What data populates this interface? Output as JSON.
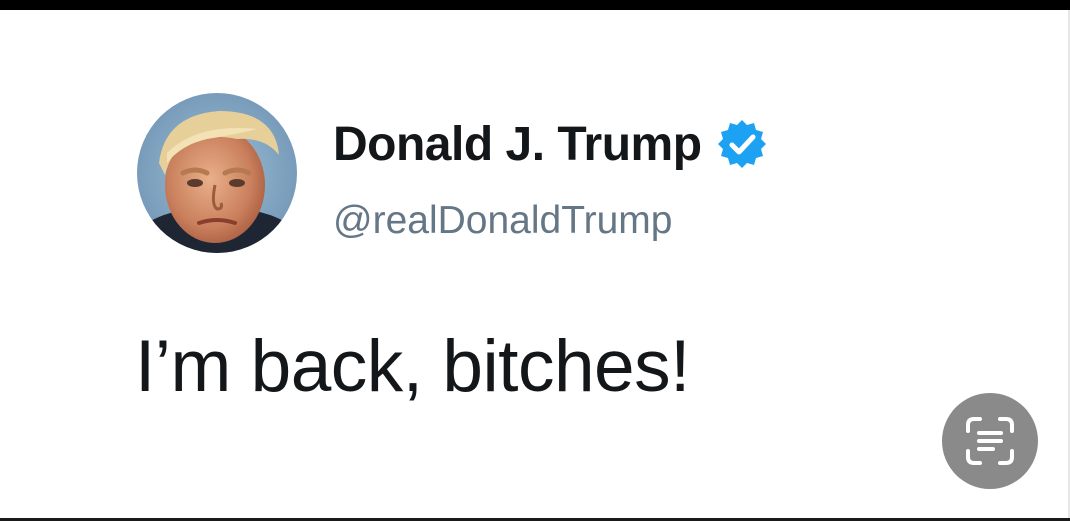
{
  "tweet": {
    "display_name": "Donald J. Trump",
    "handle": "@realDonaldTrump",
    "text": "I’m back, bitches!",
    "verified": true
  },
  "icons": {
    "avatar": "profile-photo",
    "verified": "verified-badge-icon",
    "scan": "live-text-scan-icon"
  },
  "colors": {
    "name": "#14171a",
    "handle": "#657786",
    "verified_blue": "#1da1f2",
    "scan_button_bg": "#8a8a8a",
    "top_bar": "#000000"
  }
}
